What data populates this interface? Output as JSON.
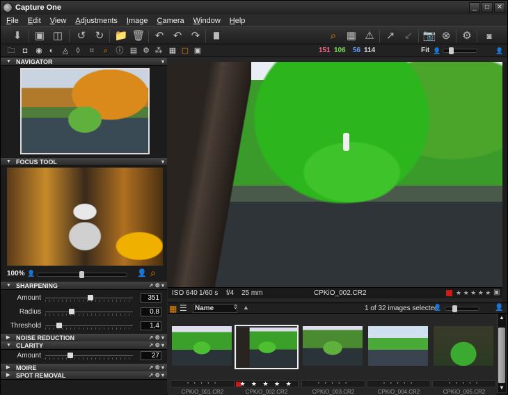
{
  "app": {
    "title": "Capture One"
  },
  "window_buttons": [
    "_",
    "□",
    "✕"
  ],
  "menu": [
    "File",
    "Edit",
    "View",
    "Adjustments",
    "Image",
    "Camera",
    "Window",
    "Help"
  ],
  "readout": {
    "r": "151",
    "g": "106",
    "b": "56",
    "lum": "114",
    "fit_label": "Fit"
  },
  "colors": {
    "accent": "#f08a00",
    "r": "#ff6a8a",
    "g": "#7adf5a",
    "b": "#6aa0ff",
    "lum": "#dddddd",
    "rating_flag": "#d01818"
  },
  "panels": {
    "navigator": "NAVIGATOR",
    "focus_tool": "FOCUS TOOL",
    "sharpening": "SHARPENING",
    "noise_reduction": "NOISE REDUCTION",
    "clarity": "CLARITY",
    "moire": "MOIRE",
    "spot_removal": "SPOT REMOVAL"
  },
  "focus": {
    "zoom": "100%"
  },
  "sharpening": [
    {
      "label": "Amount",
      "value": "351",
      "pos": 0.47
    },
    {
      "label": "Radius",
      "value": "0,8",
      "pos": 0.27
    },
    {
      "label": "Threshold",
      "value": "1,4",
      "pos": 0.13
    }
  ],
  "clarity": [
    {
      "label": "Amount",
      "value": "27",
      "pos": 0.25
    }
  ],
  "viewer_info": {
    "iso": "ISO 640",
    "shutter": "1/60 s",
    "aperture": "f/4",
    "focal": "25 mm",
    "filename": "CPKiO_002.CR2",
    "stars": "★ ★ ★ ★ ★"
  },
  "browser": {
    "sort_label": "Name",
    "selection": "1 of 32 images selected"
  },
  "thumbnails": [
    {
      "stars": "• • • • •",
      "name": "CPKiO_001.CR2"
    },
    {
      "stars": "★ ★ ★ ★ ★",
      "name": "CPKiO_002.CR2"
    },
    {
      "stars": "• • • • •",
      "name": "CPKiO_003.CR2"
    },
    {
      "stars": "• • • • •",
      "name": "CPKiO_004.CR2"
    },
    {
      "stars": "• • • • •",
      "name": "CPKiO_005.CR2"
    }
  ]
}
